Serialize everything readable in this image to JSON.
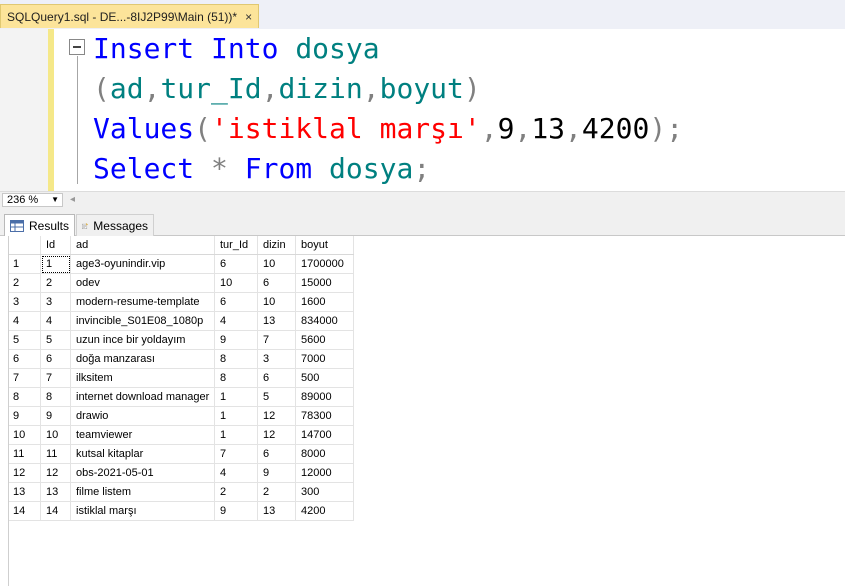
{
  "document_tab": {
    "title": "SQLQuery1.sql - DE...-8IJ2P99\\Main (51))*",
    "close": "×"
  },
  "editor": {
    "line1": {
      "kw1": "Insert",
      "kw2": "Into",
      "table": "dosya"
    },
    "line2": {
      "open": "(",
      "c1": "ad",
      "c2": "tur_Id",
      "c3": "dizin",
      "c4": "boyut",
      "close": ")",
      "comma": ","
    },
    "line3": {
      "kw": "Values",
      "open": "(",
      "str": "'istiklal marşı'",
      "v1": "9",
      "v2": "13",
      "v3": "4200",
      "close": ")",
      "semi": ";"
    },
    "line4": {
      "kw1": "Select",
      "star": "*",
      "kw2": "From",
      "table": "dosya",
      "semi": ";"
    }
  },
  "zoom": {
    "value": "236 %"
  },
  "result_tabs": {
    "results": "Results",
    "messages": "Messages"
  },
  "grid": {
    "columns": [
      "",
      "Id",
      "ad",
      "tur_Id",
      "dizin",
      "boyut"
    ],
    "rows": [
      [
        "1",
        "1",
        "age3-oyunindir.vip",
        "6",
        "10",
        "1700000"
      ],
      [
        "2",
        "2",
        "odev",
        "10",
        "6",
        "15000"
      ],
      [
        "3",
        "3",
        "modern-resume-template",
        "6",
        "10",
        "1600"
      ],
      [
        "4",
        "4",
        "invincible_S01E08_1080p",
        "4",
        "13",
        "834000"
      ],
      [
        "5",
        "5",
        "uzun ince bir yoldayım",
        "9",
        "7",
        "5600"
      ],
      [
        "6",
        "6",
        "doğa manzarası",
        "8",
        "3",
        "7000"
      ],
      [
        "7",
        "7",
        "ilksitem",
        "8",
        "6",
        "500"
      ],
      [
        "8",
        "8",
        "internet download manager",
        "1",
        "5",
        "89000"
      ],
      [
        "9",
        "9",
        "drawio",
        "1",
        "12",
        "78300"
      ],
      [
        "10",
        "10",
        "teamviewer",
        "1",
        "12",
        "14700"
      ],
      [
        "11",
        "11",
        "kutsal kitaplar",
        "7",
        "6",
        "8000"
      ],
      [
        "12",
        "12",
        "obs-2021-05-01",
        "4",
        "9",
        "12000"
      ],
      [
        "13",
        "13",
        "filme listem",
        "2",
        "2",
        "300"
      ],
      [
        "14",
        "14",
        "istiklal marşı",
        "9",
        "13",
        "4200"
      ]
    ]
  },
  "colors": {
    "keyword": "#0000ff",
    "identifier": "#008080",
    "string": "#ff0000",
    "operator": "#808080",
    "tab_active": "#fce49a"
  }
}
